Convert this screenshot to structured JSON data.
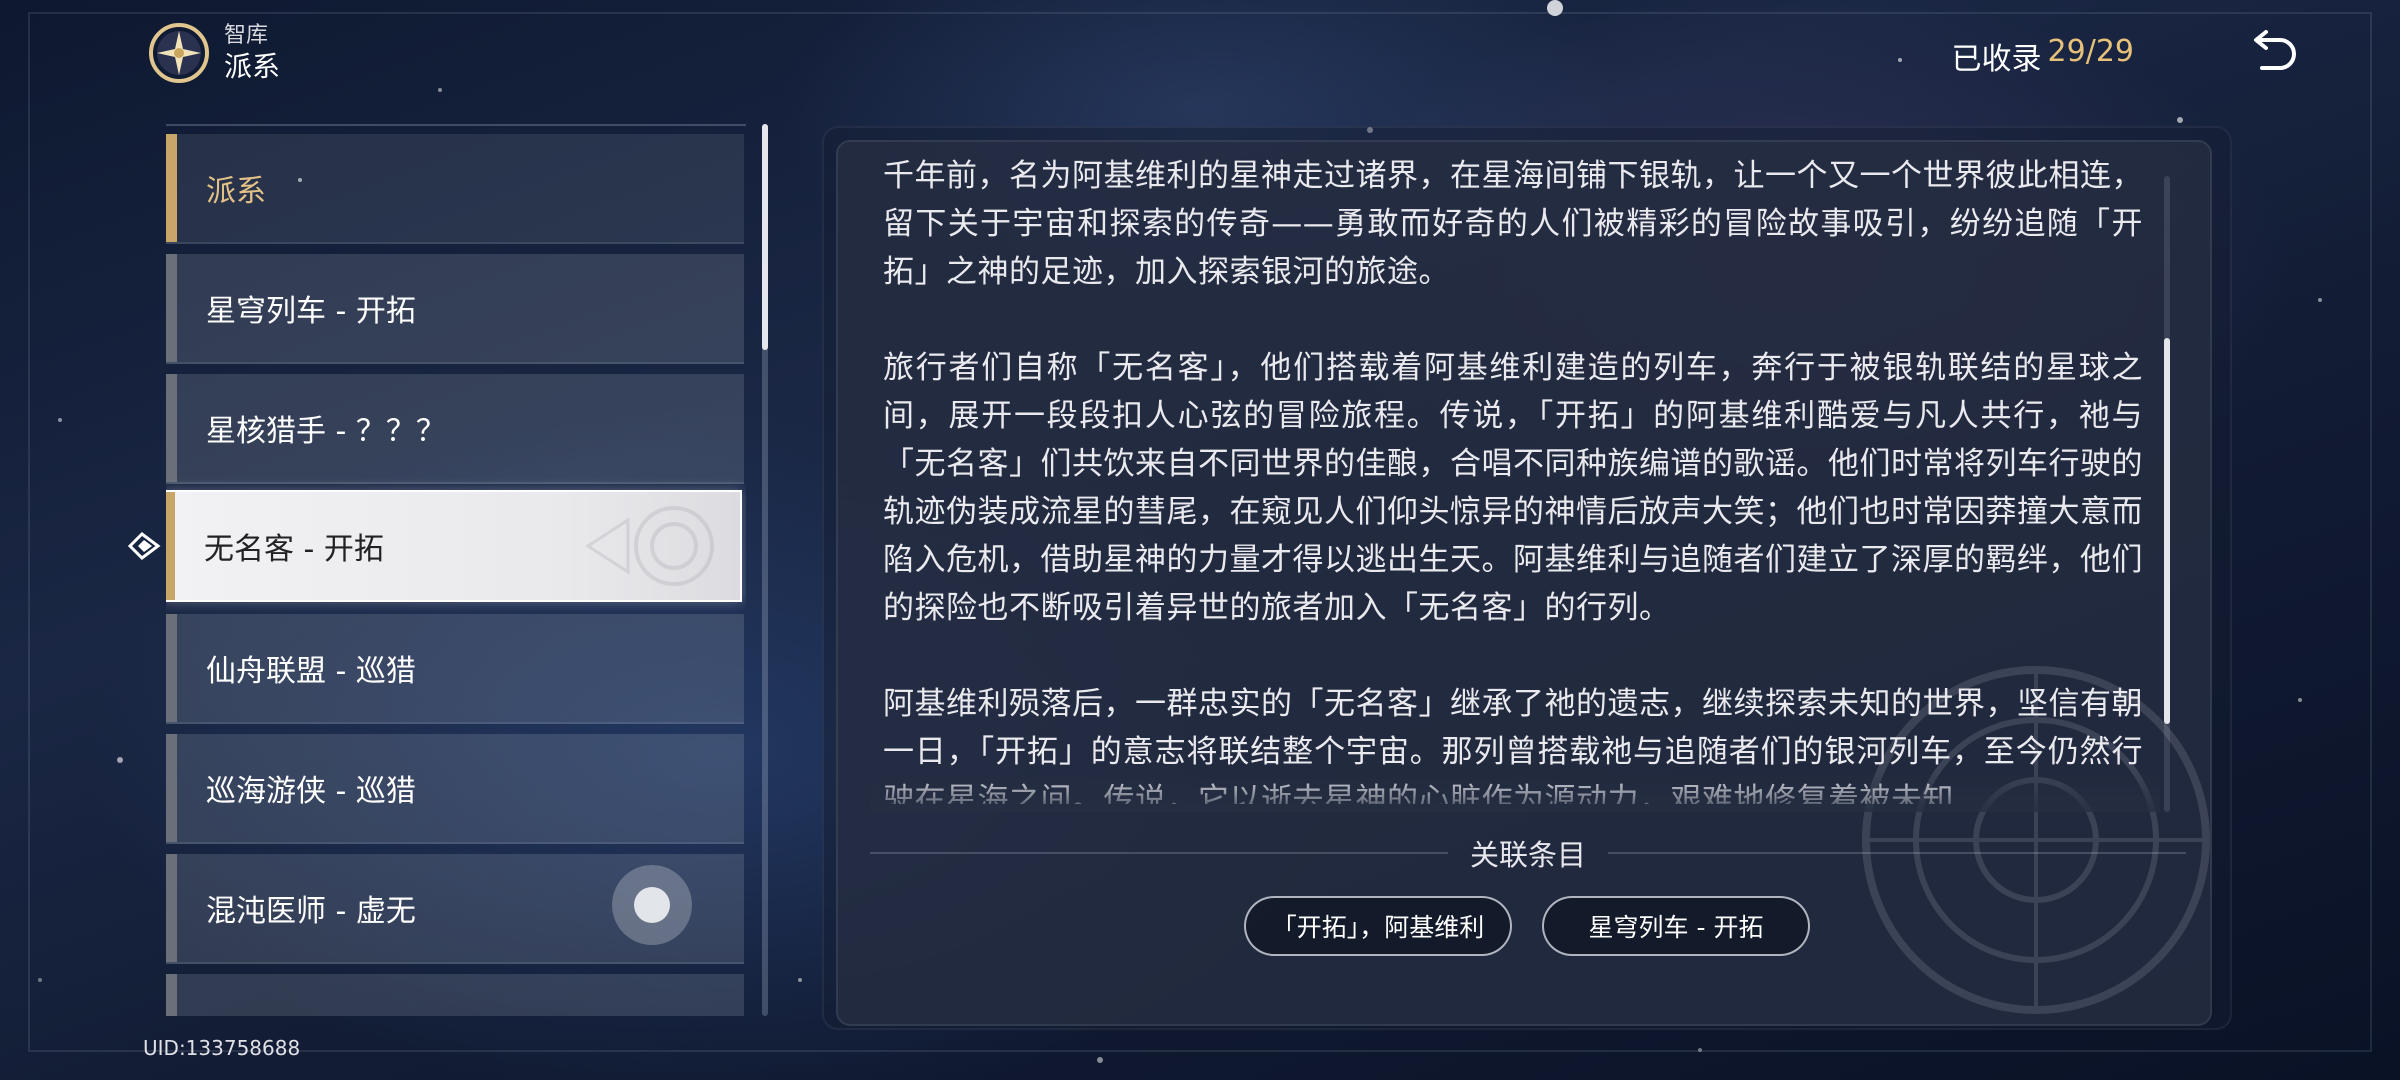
{
  "header": {
    "breadcrumb_top": "智库",
    "title": "派系",
    "collected_label": "已收录",
    "collected_count": "29/29",
    "logo_icon": "archive-emblem-icon",
    "back_icon": "return-arrow-icon"
  },
  "list": {
    "items": [
      {
        "label": "派系",
        "kind": "category"
      },
      {
        "label": "星穹列车 - 开拓"
      },
      {
        "label": "星核猎手 - ？？？"
      },
      {
        "label": "无名客 - 开拓",
        "selected": true
      },
      {
        "label": "仙舟联盟 - 巡猎"
      },
      {
        "label": "巡海游侠 - 巡猎"
      },
      {
        "label": "混沌医师 - 虚无"
      }
    ]
  },
  "content": {
    "paragraphs": [
      "千年前，名为阿基维利的星神走过诸界，在星海间铺下银轨，让一个又一个世界彼此相连，留下关于宇宙和探索的传奇——勇敢而好奇的人们被精彩的冒险故事吸引，纷纷追随「开拓」之神的足迹，加入探索银河的旅途。",
      "旅行者们自称「无名客」，他们搭载着阿基维利建造的列车，奔行于被银轨联结的星球之间，展开一段段扣人心弦的冒险旅程。传说，「开拓」的阿基维利酷爱与凡人共行，祂与「无名客」们共饮来自不同世界的佳酿，合唱不同种族编谱的歌谣。他们时常将列车行驶的轨迹伪装成流星的彗尾，在窥见人们仰头惊异的神情后放声大笑；他们也时常因莽撞大意而陷入危机，借助星神的力量才得以逃出生天。阿基维利与追随者们建立了深厚的羁绊，他们的探险也不断吸引着异世的旅者加入「无名客」的行列。",
      "阿基维利殒落后，一群忠实的「无名客」继承了祂的遗志，继续探索未知的世界，坚信有朝一日，「开拓」的意志将联结整个宇宙。那列曾搭载祂与追随者们的银河列车，至今仍然行驶在星海之间。传说，它以逝去星神的心脏作为源动力，艰难地修复着被未知"
    ]
  },
  "related": {
    "title": "关联条目",
    "chips": [
      "「开拓」，阿基维利",
      "星穹列车 - 开拓"
    ]
  },
  "footer": {
    "uid": "UID:133758688"
  },
  "colors": {
    "accent_gold": "#e6c17a",
    "selected_bg": "#f2f2f4"
  }
}
